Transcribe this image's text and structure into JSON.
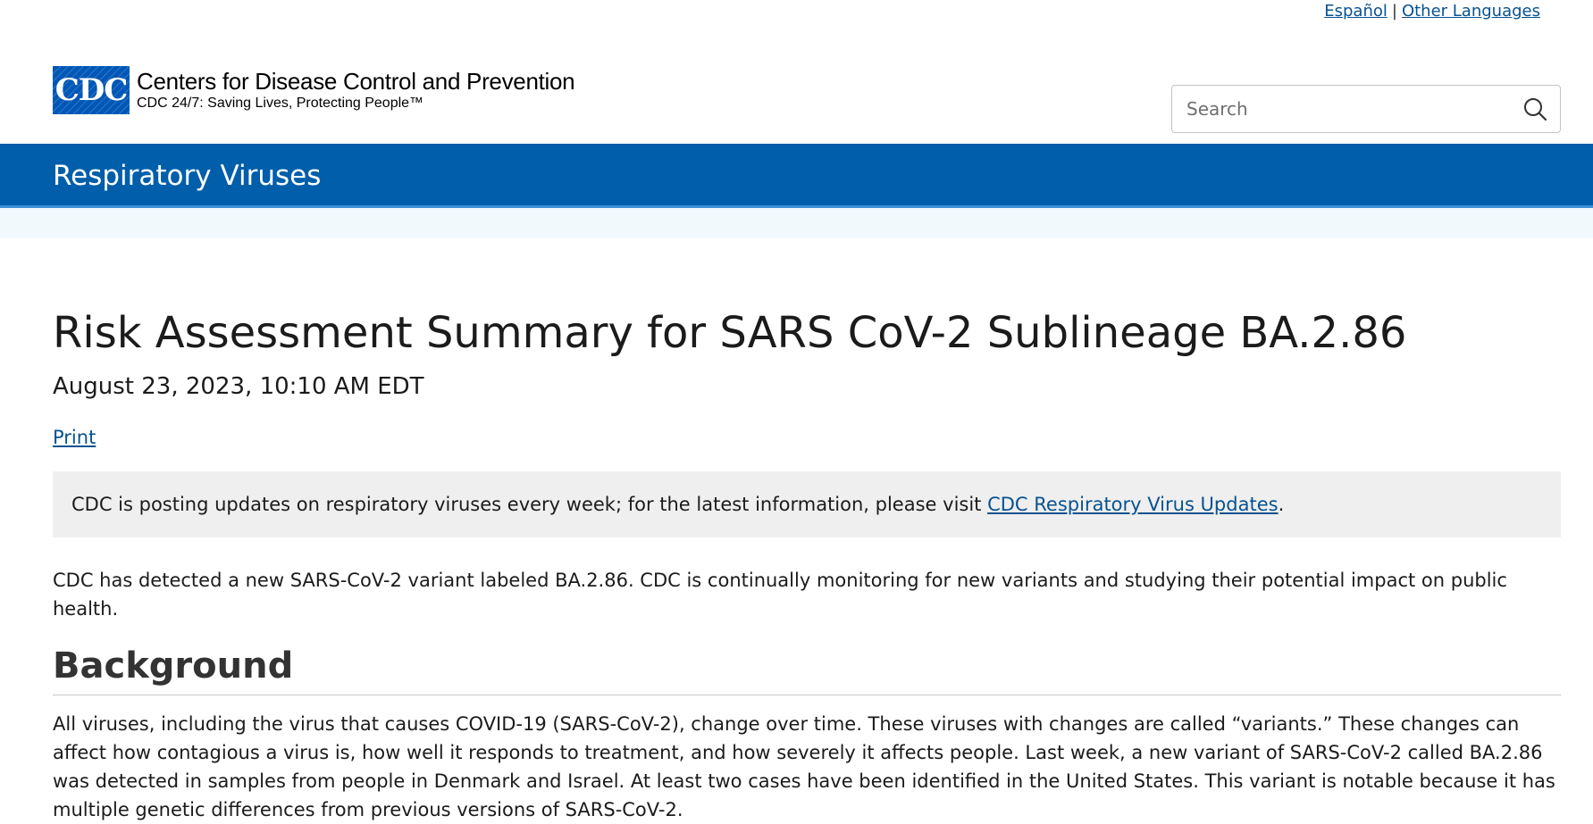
{
  "utility": {
    "lang_es": "Español",
    "separator": "|",
    "lang_other": "Other Languages"
  },
  "header": {
    "logo_letters": "CDC",
    "org_name": "Centers for Disease Control and Prevention",
    "tagline": "CDC 24/7: Saving Lives, Protecting People™"
  },
  "search": {
    "placeholder": "Search",
    "icon": "search-icon"
  },
  "banner": {
    "title": "Respiratory Viruses",
    "color": "#005eaa"
  },
  "article": {
    "title": "Risk Assessment Summary for SARS CoV-2 Sublineage BA.2.86",
    "date": "August 23, 2023, 10:10 AM EDT",
    "print_label": "Print",
    "notice_text": "CDC is posting updates on respiratory viruses every week; for the latest information, please visit ",
    "notice_link": "CDC Respiratory Virus Updates",
    "notice_end": ".",
    "intro": "CDC has detected a new SARS-CoV-2 variant labeled BA.2.86. CDC is continually monitoring for new variants and studying their potential impact on public health.",
    "section_heading": "Background",
    "background_text": "All viruses, including the virus that causes COVID-19 (SARS-CoV-2), change over time. These viruses with changes are called “variants.”  These changes can affect how contagious a virus is, how well it responds to treatment, and how severely it affects people. Last week, a new variant of SARS-CoV-2 called BA.2.86 was detected in samples from people in Denmark and Israel. At least two cases have been identified in the United States. This variant is notable because it has multiple genetic differences from previous versions of SARS-CoV-2."
  }
}
